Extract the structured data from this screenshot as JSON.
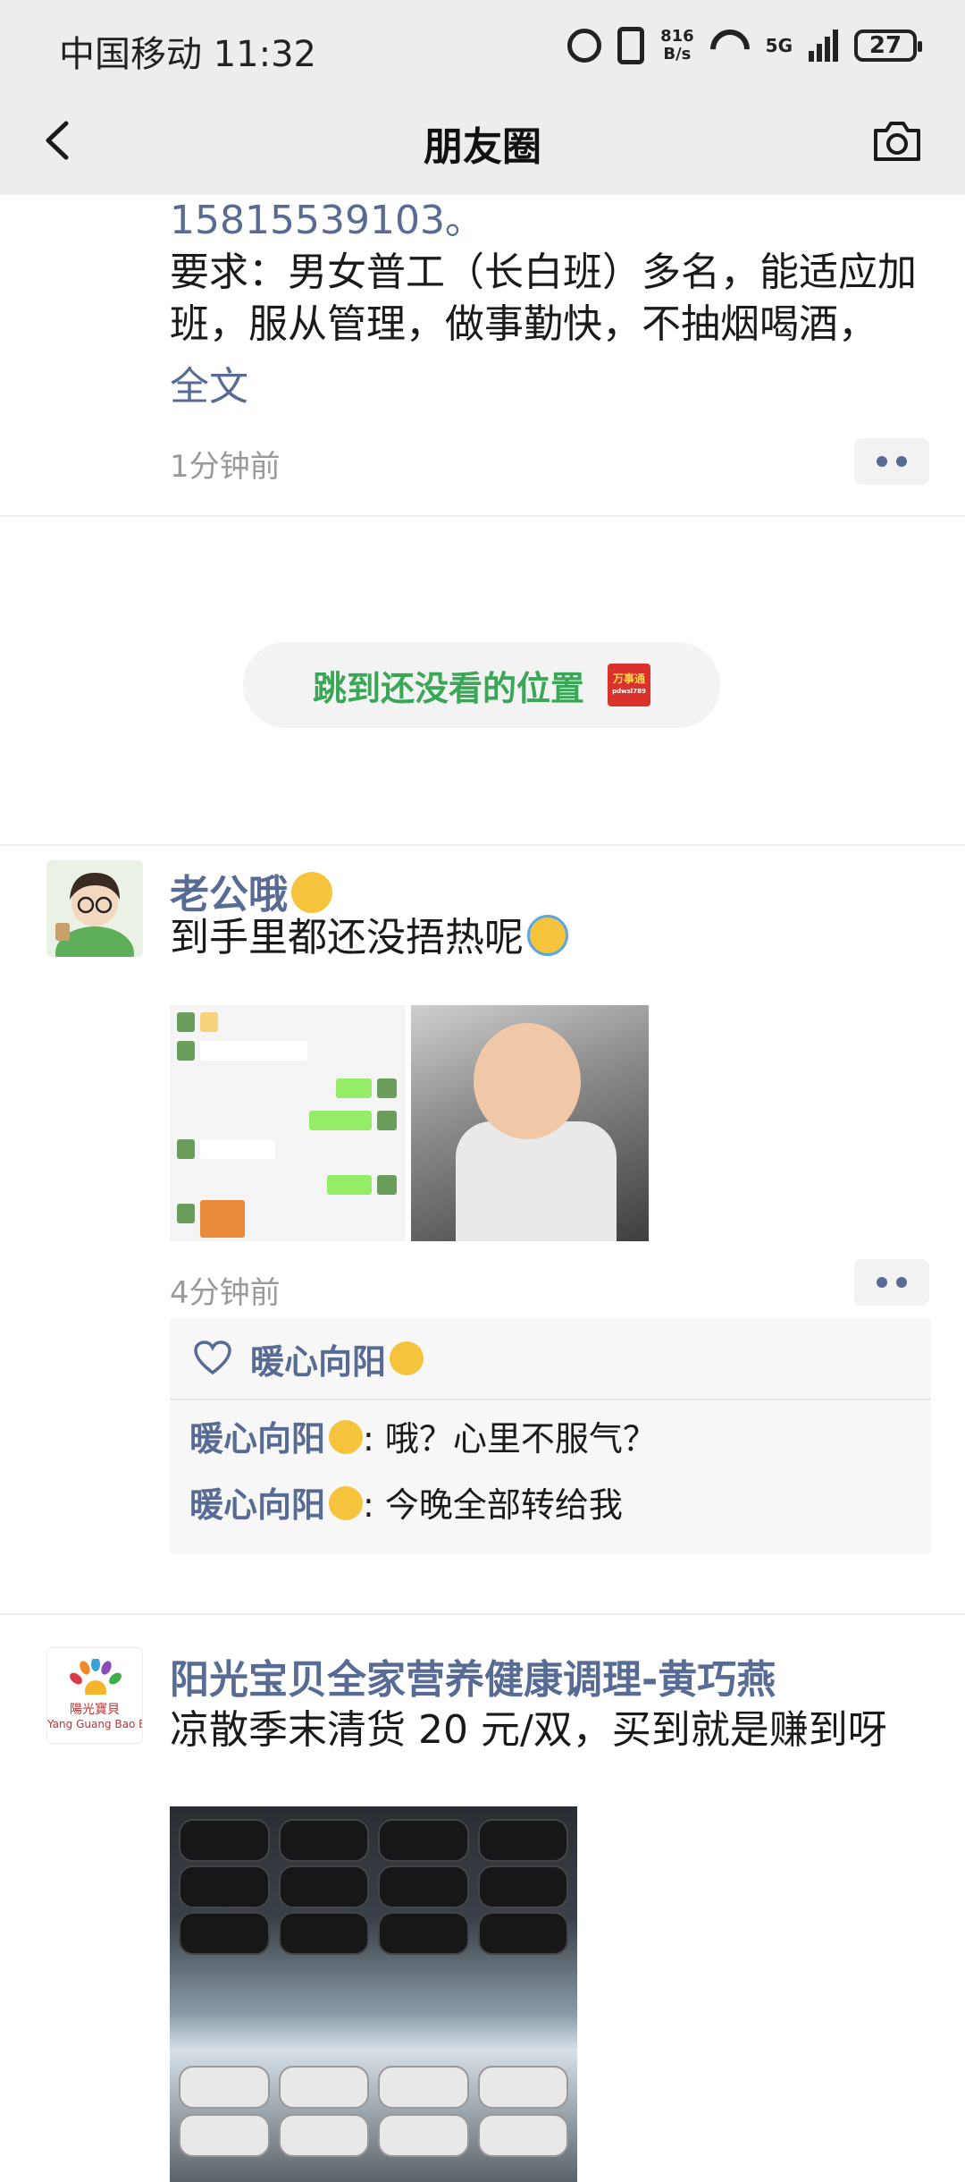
{
  "status_bar": {
    "carrier_time": "中国移动 11:32",
    "net_speed_top": "816",
    "net_speed_bottom": "B/s",
    "network": "5G",
    "battery": "27"
  },
  "nav": {
    "title": "朋友圈"
  },
  "post_partial": {
    "phone": "15815539103。",
    "requirement": "要求：男女普工（长白班）多名，能适应加班，服从管理，做事勤快，不抽烟喝酒，",
    "full_text_link": "全文",
    "time": "1分钟前"
  },
  "jump": {
    "label": "跳到还没看的位置",
    "logo_line1": "万事通",
    "logo_line2": "pdwsl789"
  },
  "posts": [
    {
      "author": "老公哦",
      "text": "到手里都还没捂热呢",
      "time": "4分钟前",
      "likes": [
        "暖心向阳"
      ],
      "comments": [
        {
          "author": "暖心向阳",
          "text": ": 哦？心里不服气？"
        },
        {
          "author": "暖心向阳",
          "text": ": 今晚全部转给我"
        }
      ]
    },
    {
      "author": "阳光宝贝全家营养健康调理-黄巧燕",
      "text": "凉散季末清货 20 元/双，买到就是赚到呀",
      "avatar_text": "陽光寶貝",
      "avatar_sub": "Yang Guang Bao Bei"
    }
  ],
  "colors": {
    "link": "#576b95",
    "jump_green": "#3aa757",
    "topbar_bg": "#ededed"
  },
  "icons": [
    "back-arrow-icon",
    "camera-icon",
    "more-dots-icon",
    "heart-icon",
    "alarm-icon",
    "vibrate-icon",
    "wifi-icon",
    "signal-icon",
    "battery-icon"
  ]
}
